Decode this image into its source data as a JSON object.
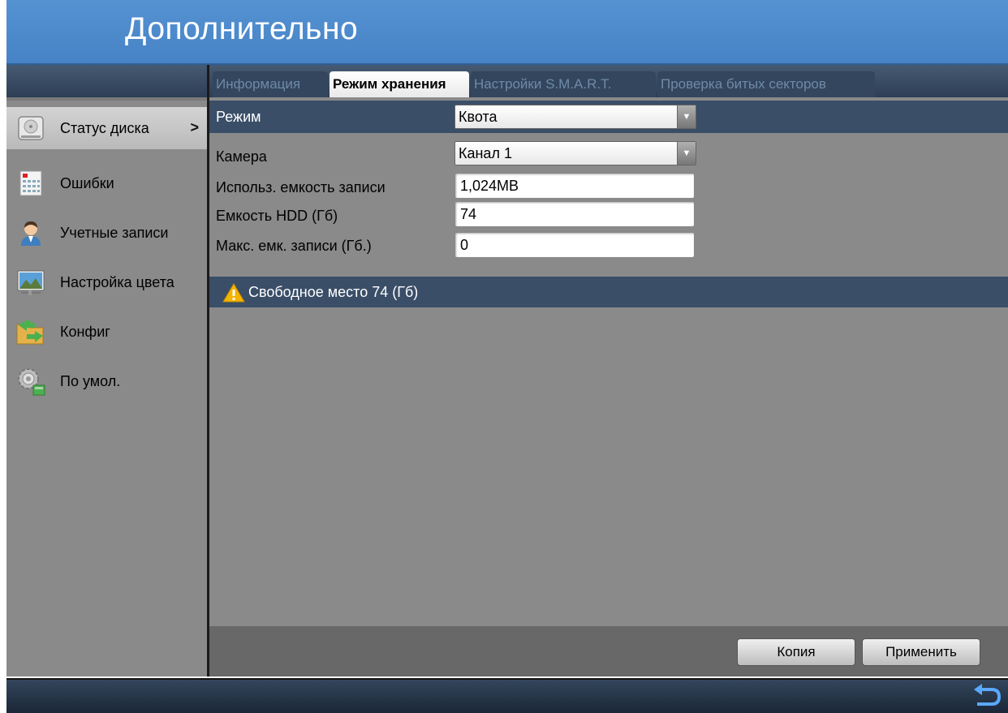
{
  "header": {
    "title": "Дополнительно"
  },
  "sidebar": {
    "items": [
      {
        "label": "Статус диска",
        "icon": "disk-icon",
        "active": true
      },
      {
        "label": "Ошибки",
        "icon": "error-log-icon"
      },
      {
        "label": "Учетные записи",
        "icon": "user-account-icon"
      },
      {
        "label": "Настройка цвета",
        "icon": "color-settings-icon"
      },
      {
        "label": "Конфиг",
        "icon": "config-folder-icon"
      },
      {
        "label": "По умол.",
        "icon": "default-gear-icon"
      }
    ],
    "active_arrow": ">"
  },
  "tabs": [
    {
      "label": "Информация",
      "active": false
    },
    {
      "label": "Режим хранения",
      "active": true
    },
    {
      "label": "Настройки S.M.A.R.T.",
      "active": false
    },
    {
      "label": "Проверка битых секторов",
      "active": false
    }
  ],
  "form": {
    "mode": {
      "label": "Режим",
      "value": "Квота"
    },
    "camera": {
      "label": "Камера",
      "value": "Канал 1"
    },
    "used_capacity": {
      "label": "Использ. емкость записи",
      "value": "1,024MB"
    },
    "hdd_capacity": {
      "label": "Емкость HDD (Гб)",
      "value": "74"
    },
    "max_capacity": {
      "label": "Макс. емк. записи (Гб.)",
      "value": "0"
    }
  },
  "info": {
    "text": "Свободное место 74 (Гб)",
    "icon": "warning-icon"
  },
  "buttons": {
    "copy": "Копия",
    "apply": "Применить"
  },
  "footer": {
    "icon": "back-icon"
  },
  "colors": {
    "title_bar": "#4a88c9",
    "panel_dark": "#3a4e68",
    "panel_gray": "#8a8a8a",
    "warning": "#f5b400"
  }
}
